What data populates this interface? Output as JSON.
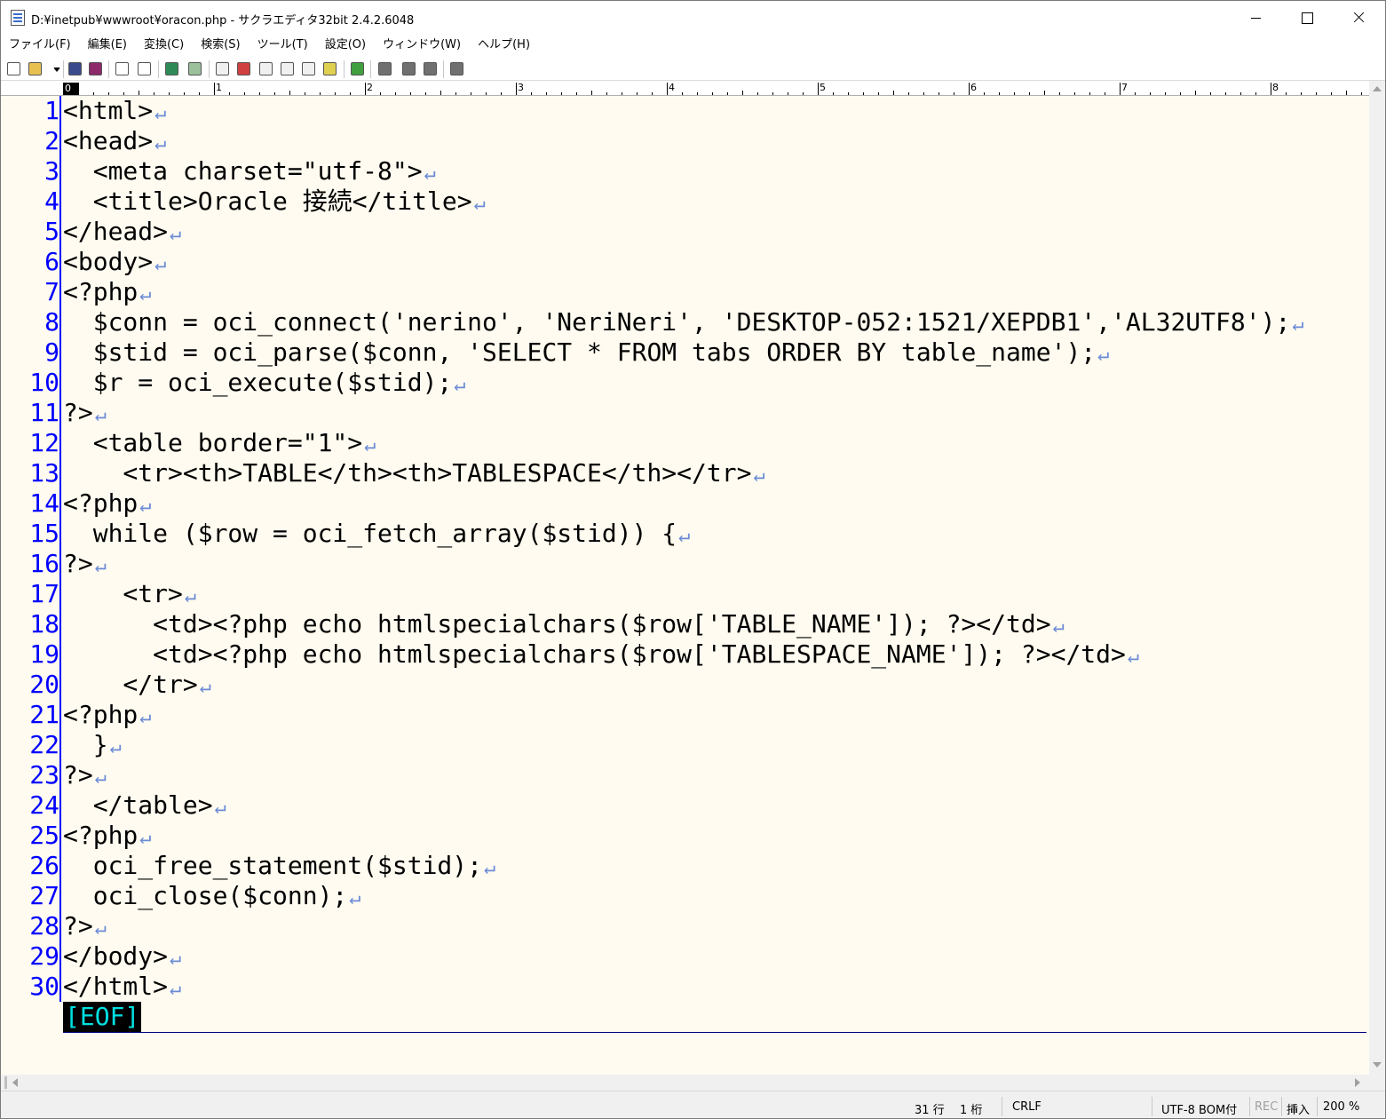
{
  "window": {
    "title": "D:¥inetpub¥wwwroot¥oracon.php - サクラエディタ32bit 2.4.2.6048",
    "buttons": {
      "minimize": "minimize-icon",
      "maximize": "maximize-icon",
      "close": "close-icon"
    }
  },
  "menu": {
    "items": [
      {
        "label": "ファイル(F)"
      },
      {
        "label": "編集(E)"
      },
      {
        "label": "変換(C)"
      },
      {
        "label": "検索(S)"
      },
      {
        "label": "ツール(T)"
      },
      {
        "label": "設定(O)"
      },
      {
        "label": "ウィンドウ(W)"
      },
      {
        "label": "ヘルプ(H)"
      }
    ]
  },
  "toolbar": {
    "buttons": [
      {
        "name": "new-file-icon",
        "color": "#ffffff"
      },
      {
        "name": "open-file-icon",
        "color": "#e8c050"
      },
      {
        "name": "open-dropdown-icon",
        "color": "#ffffff"
      },
      {
        "name": "save-icon",
        "color": "#3a4a8c"
      },
      {
        "name": "save-all-icon",
        "color": "#8c2a6a"
      },
      {
        "name": "undo-icon",
        "color": "#ffffff"
      },
      {
        "name": "redo-icon",
        "color": "#ffffff"
      },
      {
        "name": "back-jump-icon",
        "color": "#2e8b57"
      },
      {
        "name": "forward-jump-icon",
        "color": "#9bc09b"
      },
      {
        "name": "search-icon",
        "color": "#f0f0f0"
      },
      {
        "name": "search-down-icon",
        "color": "#d04040"
      },
      {
        "name": "search-up-icon",
        "color": "#f0f0f0"
      },
      {
        "name": "replace-icon",
        "color": "#f0f0f0"
      },
      {
        "name": "mark-icon",
        "color": "#f0f0f0"
      },
      {
        "name": "grep-icon",
        "color": "#e0d050"
      },
      {
        "name": "outline-icon",
        "color": "#40a040"
      },
      {
        "name": "split-view-icon",
        "color": "#707070"
      },
      {
        "name": "compare-icon",
        "color": "#707070"
      },
      {
        "name": "tag-jump-icon",
        "color": "#707070"
      },
      {
        "name": "settings-icon",
        "color": "#707070"
      }
    ]
  },
  "ruler": {
    "origin": "0",
    "labels": [
      "1",
      "2",
      "3",
      "4",
      "5",
      "6",
      "7",
      "8"
    ]
  },
  "editor": {
    "lines": [
      {
        "num": "1",
        "text": "<html>"
      },
      {
        "num": "2",
        "text": "<head>"
      },
      {
        "num": "3",
        "text": "  <meta charset=\"utf-8\">"
      },
      {
        "num": "4",
        "text": "  <title>Oracle 接続</title>"
      },
      {
        "num": "5",
        "text": "</head>"
      },
      {
        "num": "6",
        "text": "<body>"
      },
      {
        "num": "7",
        "text": "<?php"
      },
      {
        "num": "8",
        "text": "  $conn = oci_connect('nerino', 'NeriNeri', 'DESKTOP-052:1521/XEPDB1','AL32UTF8');"
      },
      {
        "num": "9",
        "text": "  $stid = oci_parse($conn, 'SELECT * FROM tabs ORDER BY table_name');"
      },
      {
        "num": "10",
        "text": "  $r = oci_execute($stid);"
      },
      {
        "num": "11",
        "text": "?>"
      },
      {
        "num": "12",
        "text": "  <table border=\"1\">"
      },
      {
        "num": "13",
        "text": "    <tr><th>TABLE</th><th>TABLESPACE</th></tr>"
      },
      {
        "num": "14",
        "text": "<?php"
      },
      {
        "num": "15",
        "text": "  while ($row = oci_fetch_array($stid)) {"
      },
      {
        "num": "16",
        "text": "?>"
      },
      {
        "num": "17",
        "text": "    <tr>"
      },
      {
        "num": "18",
        "text": "      <td><?php echo htmlspecialchars($row['TABLE_NAME']); ?></td>"
      },
      {
        "num": "19",
        "text": "      <td><?php echo htmlspecialchars($row['TABLESPACE_NAME']); ?></td>"
      },
      {
        "num": "20",
        "text": "    </tr>"
      },
      {
        "num": "21",
        "text": "<?php"
      },
      {
        "num": "22",
        "text": "  }"
      },
      {
        "num": "23",
        "text": "?>"
      },
      {
        "num": "24",
        "text": "  </table>"
      },
      {
        "num": "25",
        "text": "<?php"
      },
      {
        "num": "26",
        "text": "  oci_free_statement($stid);"
      },
      {
        "num": "27",
        "text": "  oci_close($conn);"
      },
      {
        "num": "28",
        "text": "?>"
      },
      {
        "num": "29",
        "text": "</body>"
      },
      {
        "num": "30",
        "text": "</html>"
      }
    ],
    "newline_mark": "↵",
    "eof_mark": "[EOF]",
    "colors": {
      "background": "#fffbf0",
      "line_number": "#0000ff",
      "text": "#000000",
      "newline_mark": "#6b8bd6",
      "eof_text": "#00e0e0"
    }
  },
  "status": {
    "row": "31 行",
    "col": "1 桁",
    "newline": "CRLF",
    "encoding": "UTF-8 BOM付",
    "rec": "REC",
    "mode": "挿入",
    "zoom": "200 %"
  }
}
